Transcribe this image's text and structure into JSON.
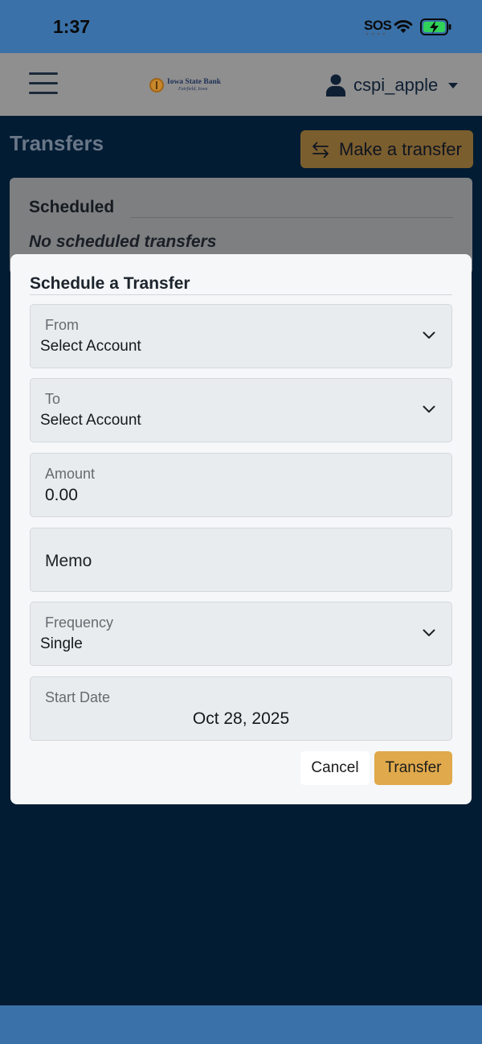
{
  "status_bar": {
    "time": "1:37",
    "sos": "SOS",
    "icons": [
      "wifi-icon",
      "battery-charging-icon"
    ]
  },
  "app_bar": {
    "menu_icon": "hamburger-menu-icon",
    "logo": {
      "bank_name": "Iowa State Bank",
      "location": "Fairfield, Iowa"
    },
    "user": {
      "icon": "user-icon",
      "name": "cspi_apple"
    }
  },
  "page": {
    "title": "Transfers",
    "make_transfer_label": "Make a transfer",
    "make_transfer_icon": "swap-arrows-icon"
  },
  "scheduled": {
    "title": "Scheduled",
    "empty_text": "No scheduled transfers"
  },
  "modal": {
    "title": "Schedule a Transfer",
    "from": {
      "label": "From",
      "value": "Select Account"
    },
    "to": {
      "label": "To",
      "value": "Select Account"
    },
    "amount": {
      "label": "Amount",
      "value": "0.00"
    },
    "memo": {
      "placeholder": "Memo"
    },
    "frequency": {
      "label": "Frequency",
      "value": "Single"
    },
    "start_date": {
      "label": "Start Date",
      "value": "Oct 28, 2025"
    },
    "cancel_label": "Cancel",
    "transfer_label": "Transfer"
  },
  "colors": {
    "status_bar": "#3a71a8",
    "background": "#021c33",
    "accent": "#e0a94b",
    "field_bg": "#e8ecee"
  }
}
